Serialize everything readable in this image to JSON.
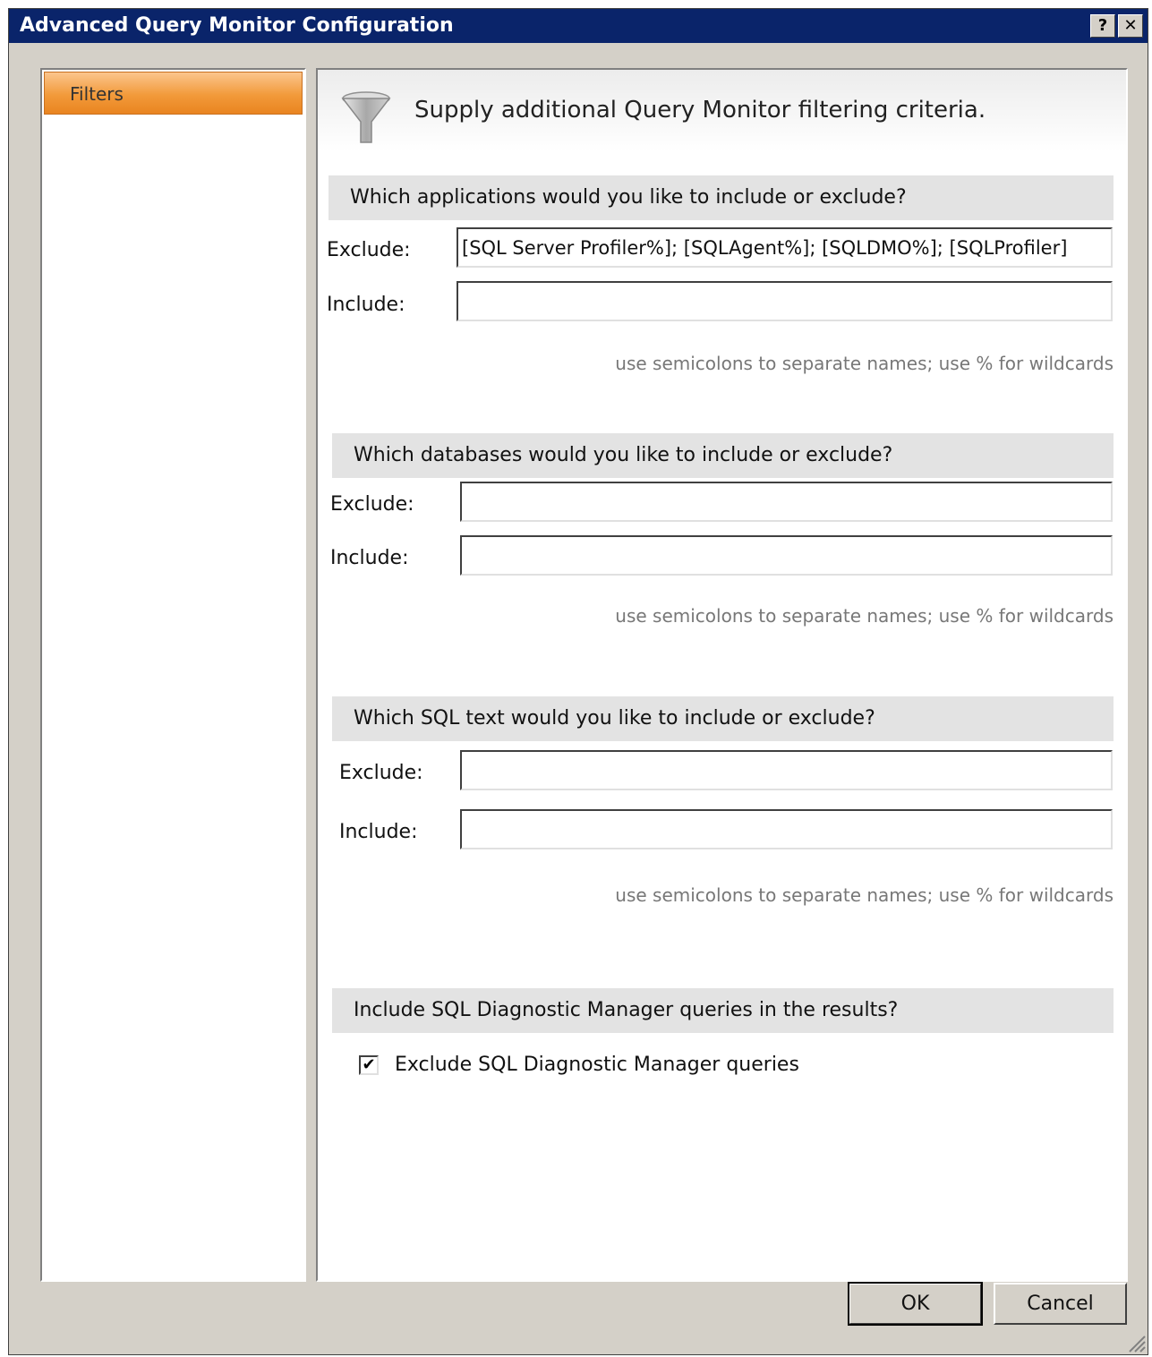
{
  "window": {
    "title": "Advanced Query Monitor Configuration",
    "help_button": "?",
    "close_button": "✕"
  },
  "nav": {
    "items": [
      {
        "label": "Filters",
        "selected": true
      }
    ]
  },
  "header": {
    "icon": "funnel-icon",
    "text": "Supply additional Query Monitor filtering criteria."
  },
  "applications": {
    "heading": "Which applications would you like to include or exclude?",
    "exclude_label": "Exclude:",
    "exclude_value": "[SQL Server Profiler%]; [SQLAgent%]; [SQLDMO%]; [SQLProfiler]",
    "include_label": "Include:",
    "include_value": "",
    "hint": "use semicolons to separate names; use % for wildcards"
  },
  "databases": {
    "heading": "Which databases would you like to include or exclude?",
    "exclude_label": "Exclude:",
    "exclude_value": "",
    "include_label": "Include:",
    "include_value": "",
    "hint": "use semicolons to separate names; use % for wildcards"
  },
  "sql_text": {
    "heading": "Which SQL text would you like to include or exclude?",
    "exclude_label": "Exclude:",
    "exclude_value": "",
    "include_label": "Include:",
    "include_value": "",
    "hint": "use semicolons to separate names; use % for wildcards"
  },
  "diagnostic": {
    "heading": "Include SQL Diagnostic Manager queries in the results?",
    "checkbox_label": "Exclude SQL Diagnostic Manager queries",
    "checked": true
  },
  "buttons": {
    "ok": "OK",
    "cancel": "Cancel"
  },
  "colors": {
    "title_bar": "#0a246a",
    "nav_selected": "#f29a3a",
    "dialog_bg": "#d4d0c8"
  }
}
